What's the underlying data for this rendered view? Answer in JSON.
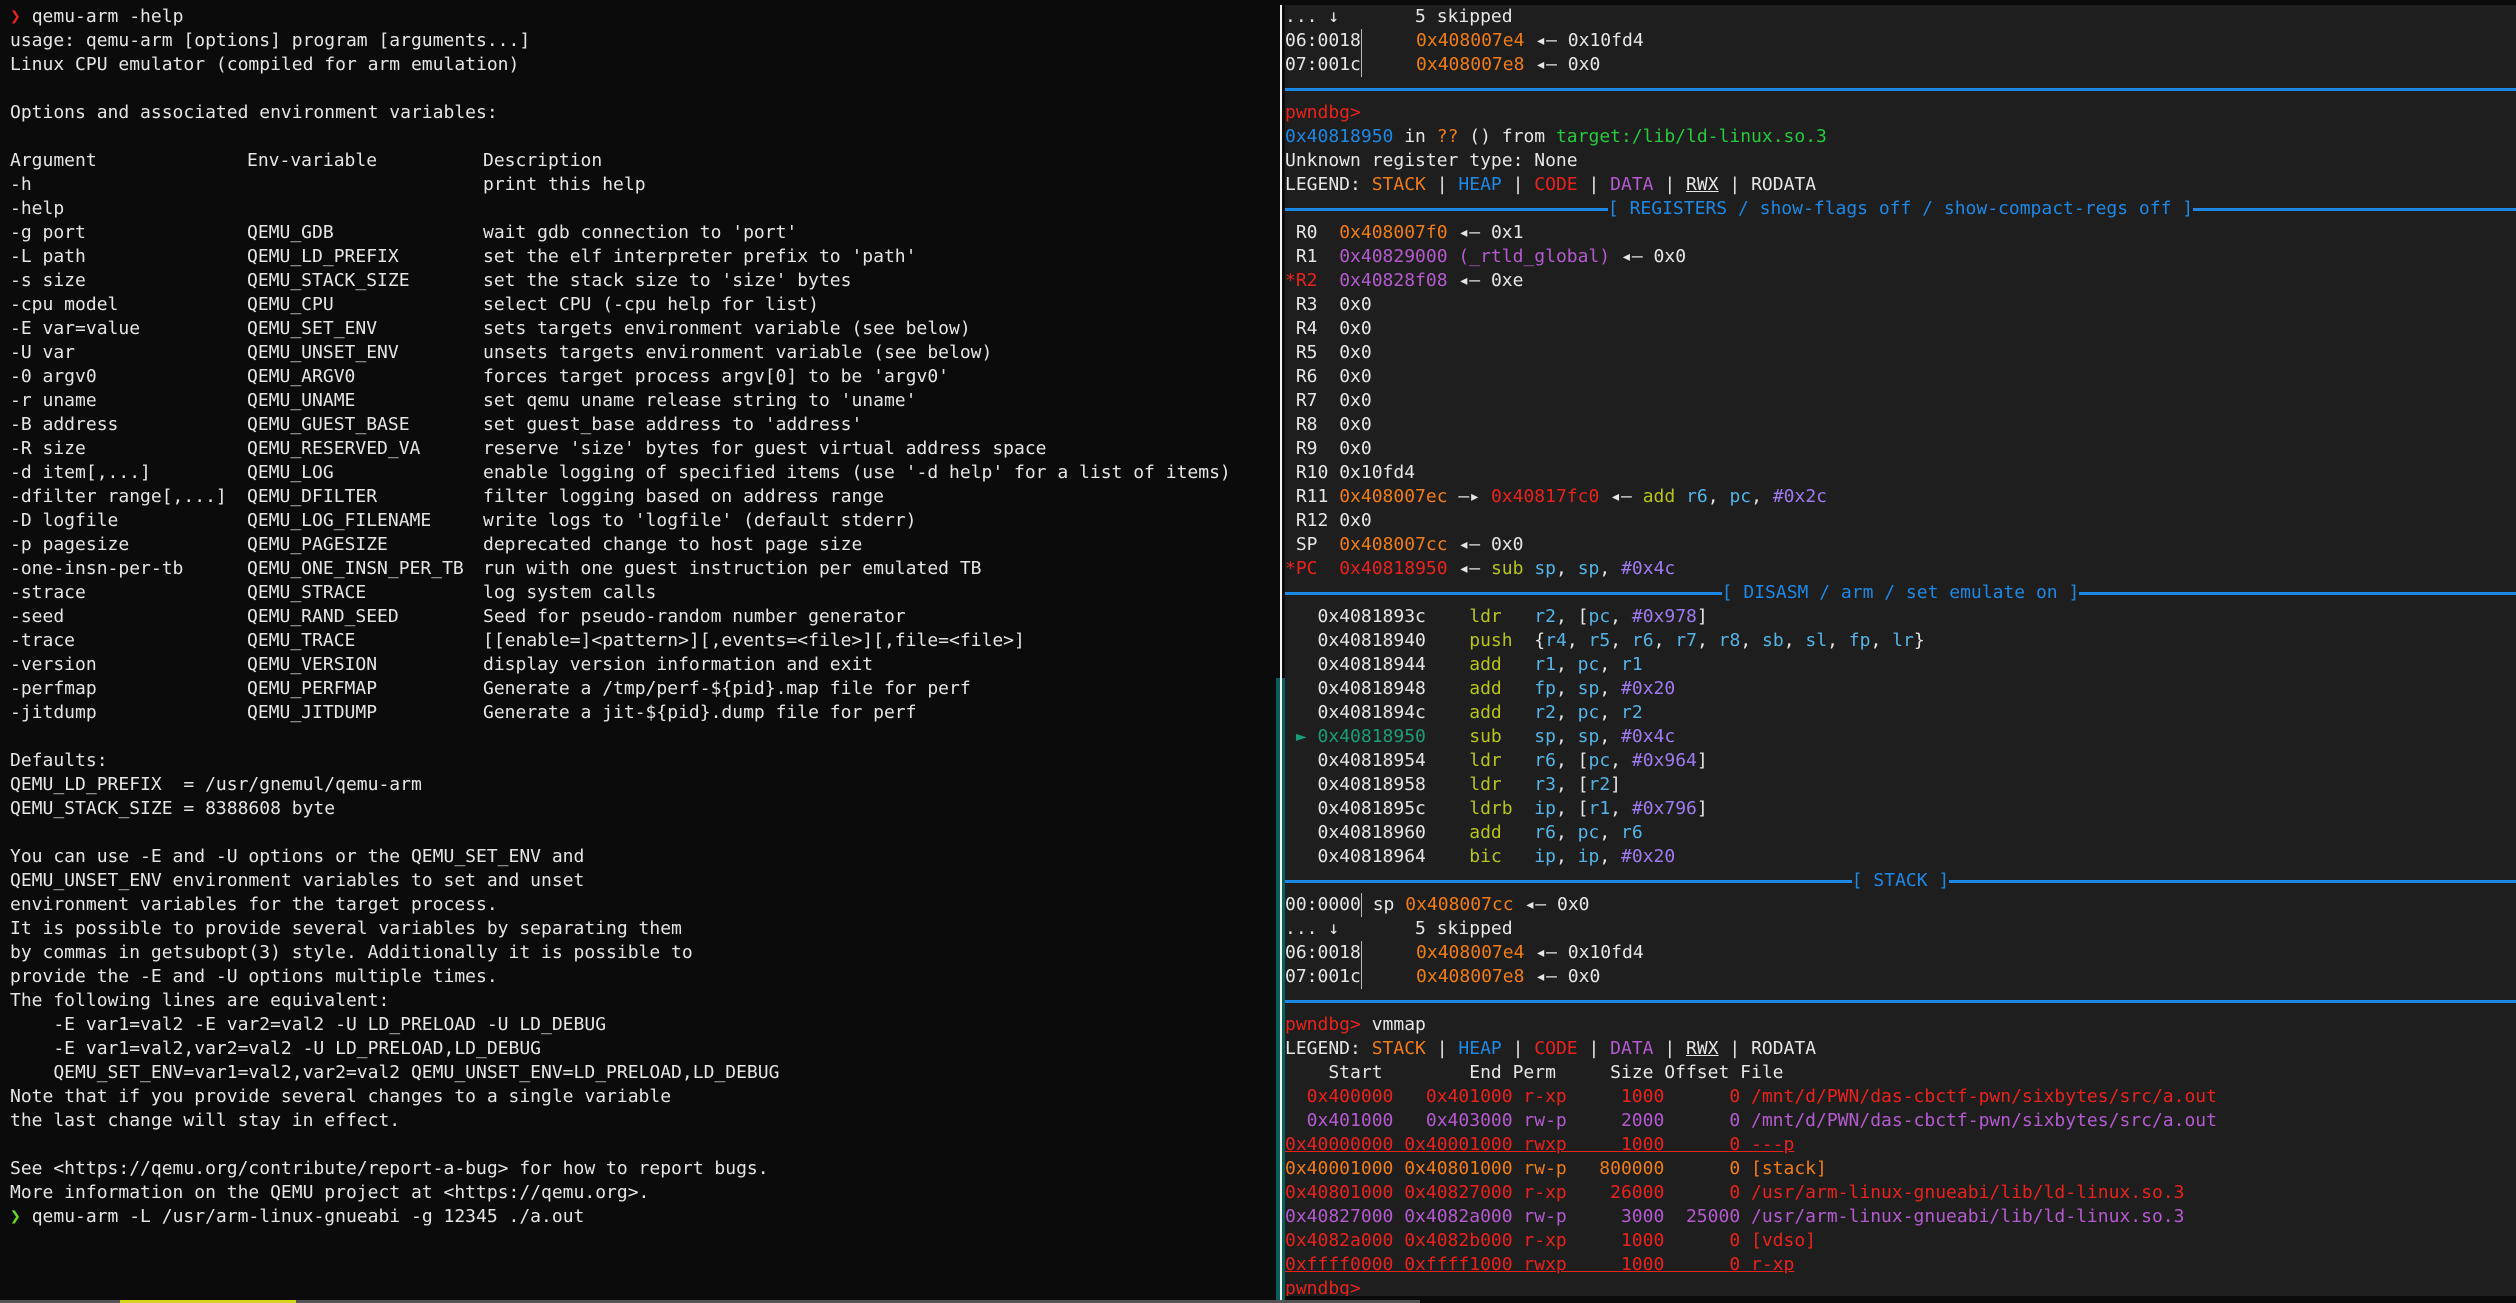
{
  "left_terminal": {
    "prompt1": {
      "symbol": "❯",
      "command": "qemu-arm -help"
    },
    "usage": "usage: qemu-arm [options] program [arguments...]",
    "desc": "Linux CPU emulator (compiled for arm emulation)",
    "options_title": "Options and associated environment variables:",
    "table_headers": {
      "argument": "Argument",
      "env": "Env-variable",
      "description": "Description"
    },
    "options": [
      {
        "arg": "-h",
        "env": "",
        "desc": "print this help"
      },
      {
        "arg": "-help",
        "env": "",
        "desc": ""
      },
      {
        "arg": "-g port",
        "env": "QEMU_GDB",
        "desc": "wait gdb connection to 'port'"
      },
      {
        "arg": "-L path",
        "env": "QEMU_LD_PREFIX",
        "desc": "set the elf interpreter prefix to 'path'"
      },
      {
        "arg": "-s size",
        "env": "QEMU_STACK_SIZE",
        "desc": "set the stack size to 'size' bytes"
      },
      {
        "arg": "-cpu model",
        "env": "QEMU_CPU",
        "desc": "select CPU (-cpu help for list)"
      },
      {
        "arg": "-E var=value",
        "env": "QEMU_SET_ENV",
        "desc": "sets targets environment variable (see below)"
      },
      {
        "arg": "-U var",
        "env": "QEMU_UNSET_ENV",
        "desc": "unsets targets environment variable (see below)"
      },
      {
        "arg": "-0 argv0",
        "env": "QEMU_ARGV0",
        "desc": "forces target process argv[0] to be 'argv0'"
      },
      {
        "arg": "-r uname",
        "env": "QEMU_UNAME",
        "desc": "set qemu uname release string to 'uname'"
      },
      {
        "arg": "-B address",
        "env": "QEMU_GUEST_BASE",
        "desc": "set guest_base address to 'address'"
      },
      {
        "arg": "-R size",
        "env": "QEMU_RESERVED_VA",
        "desc": "reserve 'size' bytes for guest virtual address space"
      },
      {
        "arg": "-d item[,...]",
        "env": "QEMU_LOG",
        "desc": "enable logging of specified items (use '-d help' for a list of items)"
      },
      {
        "arg": "-dfilter range[,...]",
        "env": "QEMU_DFILTER",
        "desc": "filter logging based on address range"
      },
      {
        "arg": "-D logfile",
        "env": "QEMU_LOG_FILENAME",
        "desc": "write logs to 'logfile' (default stderr)"
      },
      {
        "arg": "-p pagesize",
        "env": "QEMU_PAGESIZE",
        "desc": "deprecated change to host page size"
      },
      {
        "arg": "-one-insn-per-tb",
        "env": "QEMU_ONE_INSN_PER_TB",
        "desc": "run with one guest instruction per emulated TB"
      },
      {
        "arg": "-strace",
        "env": "QEMU_STRACE",
        "desc": "log system calls"
      },
      {
        "arg": "-seed",
        "env": "QEMU_RAND_SEED",
        "desc": "Seed for pseudo-random number generator"
      },
      {
        "arg": "-trace",
        "env": "QEMU_TRACE",
        "desc": "[[enable=]<pattern>][,events=<file>][,file=<file>]"
      },
      {
        "arg": "-version",
        "env": "QEMU_VERSION",
        "desc": "display version information and exit"
      },
      {
        "arg": "-perfmap",
        "env": "QEMU_PERFMAP",
        "desc": "Generate a /tmp/perf-${pid}.map file for perf"
      },
      {
        "arg": "-jitdump",
        "env": "QEMU_JITDUMP",
        "desc": "Generate a jit-${pid}.dump file for perf"
      }
    ],
    "defaults_title": "Defaults:",
    "defaults": [
      "QEMU_LD_PREFIX  = /usr/gnemul/qemu-arm",
      "QEMU_STACK_SIZE = 8388608 byte"
    ],
    "notes": [
      "You can use -E and -U options or the QEMU_SET_ENV and",
      "QEMU_UNSET_ENV environment variables to set and unset",
      "environment variables for the target process.",
      "It is possible to provide several variables by separating them",
      "by commas in getsubopt(3) style. Additionally it is possible to",
      "provide the -E and -U options multiple times.",
      "The following lines are equivalent:",
      "    -E var1=val2 -E var2=val2 -U LD_PRELOAD -U LD_DEBUG",
      "    -E var1=val2,var2=val2 -U LD_PRELOAD,LD_DEBUG",
      "    QEMU_SET_ENV=var1=val2,var2=val2 QEMU_UNSET_ENV=LD_PRELOAD,LD_DEBUG",
      "Note that if you provide several changes to a single variable",
      "the last change will stay in effect."
    ],
    "bug_report": "See <https://qemu.org/contribute/report-a-bug> for how to report bugs.",
    "more_info": "More information on the QEMU project at <https://qemu.org>.",
    "prompt2": {
      "symbol": "❯",
      "command": "qemu-arm -L /usr/arm-linux-gnueabi -g 12345 ./a.out"
    }
  },
  "right_terminal": {
    "top_stack": [
      {
        "idx": "... ↓",
        "text": "5 skipped",
        "addr": "",
        "val": ""
      },
      {
        "idx": "06:0018",
        "addr": "0x408007e4",
        "arrow": "◂—",
        "val": "0x10fd4"
      },
      {
        "idx": "07:001c",
        "addr": "0x408007e8",
        "arrow": "◂—",
        "val": "0x0"
      }
    ],
    "prompt": "pwndbg>",
    "location": {
      "addr": "0x40818950",
      "in": " in ",
      "sym": "??",
      "rest": " () from ",
      "file": "target:/lib/ld-linux.so.3"
    },
    "unknown_reg": "Unknown register type: None",
    "legend": {
      "label": "LEGEND: ",
      "stack": "STACK",
      "heap": "HEAP",
      "code": "CODE",
      "data": "DATA",
      "rwx": "RWX",
      "rodata": "RODATA",
      "sep": " | "
    },
    "registers_header": "[ REGISTERS / show-flags off / show-compact-regs off ]",
    "registers": [
      {
        "mark": " ",
        "name": "R0",
        "value": "0x408007f0",
        "value_color": "orange",
        "extra": "",
        "arrow": "◂—",
        "deref": "0x1"
      },
      {
        "mark": " ",
        "name": "R1",
        "value": "0x40829000",
        "value_color": "purple",
        "extra": " (_rtld_global)",
        "arrow": "◂—",
        "deref": "0x0"
      },
      {
        "mark": "*",
        "name": "R2",
        "value": "0x40828f08",
        "value_color": "purple",
        "extra": "",
        "arrow": "◂—",
        "deref": "0xe"
      },
      {
        "mark": " ",
        "name": "R3",
        "value": "0x0",
        "value_color": "white",
        "extra": "",
        "arrow": "",
        "deref": ""
      },
      {
        "mark": " ",
        "name": "R4",
        "value": "0x0",
        "value_color": "white",
        "extra": "",
        "arrow": "",
        "deref": ""
      },
      {
        "mark": " ",
        "name": "R5",
        "value": "0x0",
        "value_color": "white",
        "extra": "",
        "arrow": "",
        "deref": ""
      },
      {
        "mark": " ",
        "name": "R6",
        "value": "0x0",
        "value_color": "white",
        "extra": "",
        "arrow": "",
        "deref": ""
      },
      {
        "mark": " ",
        "name": "R7",
        "value": "0x0",
        "value_color": "white",
        "extra": "",
        "arrow": "",
        "deref": ""
      },
      {
        "mark": " ",
        "name": "R8",
        "value": "0x0",
        "value_color": "white",
        "extra": "",
        "arrow": "",
        "deref": ""
      },
      {
        "mark": " ",
        "name": "R9",
        "value": "0x0",
        "value_color": "white",
        "extra": "",
        "arrow": "",
        "deref": ""
      },
      {
        "mark": " ",
        "name": "R10",
        "value": "0x10fd4",
        "value_color": "white",
        "extra": "",
        "arrow": "",
        "deref": ""
      }
    ],
    "r11": {
      "name": "R11",
      "value": "0x408007ec",
      "arrow1": "—▸",
      "target": "0x40817fc0",
      "arrow2": "◂—",
      "op": "add",
      "args": [
        "r6",
        "pc",
        "#0x2c"
      ]
    },
    "r12": {
      "name": "R12",
      "value": "0x0"
    },
    "sp": {
      "name": "SP",
      "value": "0x408007cc",
      "arrow": "◂—",
      "deref": "0x0"
    },
    "pc": {
      "mark": "*",
      "name": "PC",
      "value": "0x40818950",
      "arrow": "◂—",
      "op": "sub",
      "args": [
        "sp",
        "sp",
        "#0x4c"
      ]
    },
    "disasm_header": "[ DISASM / arm / set emulate on ]",
    "disasm": [
      {
        "current": false,
        "addr": "0x4081893c",
        "op": "ldr",
        "args": "r2, [pc, #0x978]"
      },
      {
        "current": false,
        "addr": "0x40818940",
        "op": "push",
        "args": "{r4, r5, r6, r7, r8, sb, sl, fp, lr}"
      },
      {
        "current": false,
        "addr": "0x40818944",
        "op": "add",
        "args": "r1, pc, r1"
      },
      {
        "current": false,
        "addr": "0x40818948",
        "op": "add",
        "args": "fp, sp, #0x20"
      },
      {
        "current": false,
        "addr": "0x4081894c",
        "op": "add",
        "args": "r2, pc, r2"
      },
      {
        "current": true,
        "addr": "0x40818950",
        "op": "sub",
        "args": "sp, sp, #0x4c"
      },
      {
        "current": false,
        "addr": "0x40818954",
        "op": "ldr",
        "args": "r6, [pc, #0x964]"
      },
      {
        "current": false,
        "addr": "0x40818958",
        "op": "ldr",
        "args": "r3, [r2]"
      },
      {
        "current": false,
        "addr": "0x4081895c",
        "op": "ldrb",
        "args": "ip, [r1, #0x796]"
      },
      {
        "current": false,
        "addr": "0x40818960",
        "op": "add",
        "args": "r6, pc, r6"
      },
      {
        "current": false,
        "addr": "0x40818964",
        "op": "bic",
        "args": "ip, ip, #0x20"
      }
    ],
    "current_marker": "►",
    "stack_header": "[ STACK ]",
    "stack": [
      {
        "idx": "00:0000",
        "reg": "sp",
        "addr": "0x408007cc",
        "arrow": "◂—",
        "val": "0x0"
      },
      {
        "idx": "... ↓",
        "text": "5 skipped"
      },
      {
        "idx": "06:0018",
        "reg": "",
        "addr": "0x408007e4",
        "arrow": "◂—",
        "val": "0x10fd4"
      },
      {
        "idx": "07:001c",
        "reg": "",
        "addr": "0x408007e8",
        "arrow": "◂—",
        "val": "0x0"
      }
    ],
    "vmmap_command": "vmmap",
    "vmmap_headers": "    Start        End Perm     Size Offset File",
    "vmmap": [
      {
        "start": "0x400000",
        "end": "0x401000",
        "perm": "r-xp",
        "size": "1000",
        "offset": "0",
        "file": "/mnt/d/PWN/das-cbctf-pwn/sixbytes/src/a.out",
        "color": "red",
        "underline": false
      },
      {
        "start": "0x401000",
        "end": "0x403000",
        "perm": "rw-p",
        "size": "2000",
        "offset": "0",
        "file": "/mnt/d/PWN/das-cbctf-pwn/sixbytes/src/a.out",
        "color": "purple",
        "underline": false
      },
      {
        "start": "0x40000000",
        "end": "0x40001000",
        "perm": "rwxp",
        "size": "1000",
        "offset": "0",
        "file": "---p",
        "color": "red",
        "underline": true
      },
      {
        "start": "0x40001000",
        "end": "0x40801000",
        "perm": "rw-p",
        "size": "800000",
        "offset": "0",
        "file": "[stack]",
        "color": "orange",
        "underline": false
      },
      {
        "start": "0x40801000",
        "end": "0x40827000",
        "perm": "r-xp",
        "size": "26000",
        "offset": "0",
        "file": "/usr/arm-linux-gnueabi/lib/ld-linux.so.3",
        "color": "red",
        "underline": false
      },
      {
        "start": "0x40827000",
        "end": "0x4082a000",
        "perm": "rw-p",
        "size": "3000",
        "offset": "25000",
        "file": "/usr/arm-linux-gnueabi/lib/ld-linux.so.3",
        "color": "purple",
        "underline": false
      },
      {
        "start": "0x4082a000",
        "end": "0x4082b000",
        "perm": "r-xp",
        "size": "1000",
        "offset": "0",
        "file": "[vdso]",
        "color": "red",
        "underline": false
      },
      {
        "start": "0xffff0000",
        "end": "0xffff1000",
        "perm": "rwxp",
        "size": "1000",
        "offset": "0",
        "file": "r-xp",
        "color": "red",
        "underline": true
      }
    ],
    "final_prompt": "pwndbg>"
  },
  "colors": {
    "red": "#e8231e",
    "orange": "#f07d17",
    "blue": "#1e88e5",
    "purple": "#b45bcf",
    "green": "#27c93f",
    "yellow": "#b7c41a",
    "cyan": "#55b4e6",
    "lavender": "#9f7bef",
    "white": "#e6e6e6",
    "teal": "#1b9e77"
  }
}
